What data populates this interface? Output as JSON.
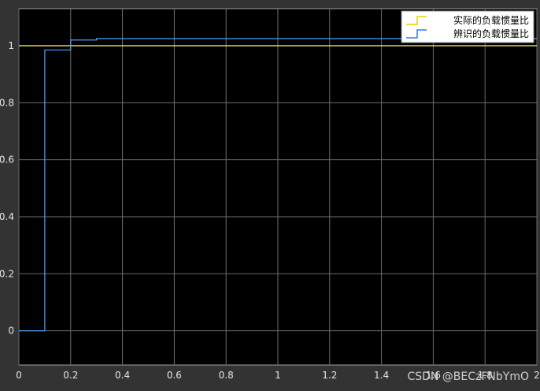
{
  "chart_data": {
    "type": "line",
    "background": "#000000",
    "figure_color": "#333333",
    "grid": true,
    "grid_color": "#6b6b6b",
    "axis_text_color": "#e6e6e6",
    "xlim": [
      0,
      2
    ],
    "ylim": [
      -0.12,
      1.13
    ],
    "xticks": [
      0,
      0.2,
      0.4,
      0.6,
      0.8,
      1,
      1.2,
      1.4,
      1.6,
      1.8,
      2
    ],
    "xtick_labels": [
      "0",
      "0.2",
      "0.4",
      "0.6",
      "0.8",
      "1",
      "1.2",
      "1.4",
      "1.6",
      "1.8",
      "2"
    ],
    "yticks": [
      0,
      0.2,
      0.4,
      0.6,
      0.8,
      1
    ],
    "ytick_labels": [
      "0",
      "0.2",
      "0.4",
      "0.6",
      "0.8",
      "1"
    ],
    "legend_position": "top-right",
    "series": [
      {
        "name": "实际的负载惯量比",
        "color": "#ffff66",
        "x": [
          0,
          2
        ],
        "y": [
          1,
          1
        ]
      },
      {
        "name": "辨识的负载惯量比",
        "color": "#4d9fff",
        "step": true,
        "x": [
          0,
          0.1,
          0.2,
          0.3,
          2
        ],
        "y": [
          0,
          0.985,
          1.02,
          1.025,
          1.025
        ]
      }
    ]
  },
  "watermark": "CSDN @BECzFNbYmO"
}
